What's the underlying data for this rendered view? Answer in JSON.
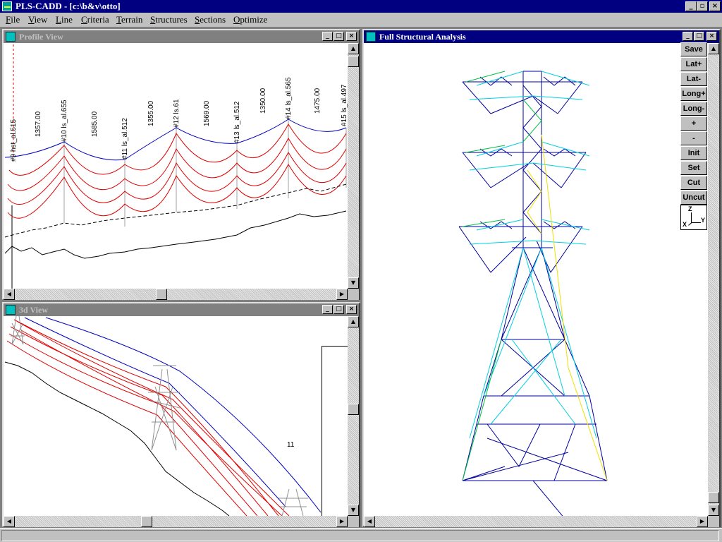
{
  "app": {
    "title": "PLS-CADD - [c:\\b&v\\otto]",
    "window_buttons": {
      "minimize": "_",
      "restore": "▫",
      "close": "×"
    }
  },
  "menu": {
    "items": [
      "File",
      "View",
      "Line",
      "Criteria",
      "Terrain",
      "Structures",
      "Sections",
      "Optimize"
    ]
  },
  "windows": {
    "profile": {
      "title": "Profile View"
    },
    "view3d": {
      "title": "3d View",
      "marker": "11"
    },
    "structural": {
      "title": "Full Structural Analysis"
    }
  },
  "toolbar": {
    "buttons": [
      "Save",
      "Lat+",
      "Lat-",
      "Long+",
      "Long-",
      "+",
      "-",
      "Init",
      "Set",
      "Cut",
      "Uncut"
    ],
    "axis": {
      "z": "Z",
      "x": "X",
      "y": "Y"
    }
  },
  "profile": {
    "structure_labels": [
      {
        "text": "#9 hst_al.515"
      },
      {
        "text": "#10 ls_al.655"
      },
      {
        "text": "#11 ls_al.512"
      },
      {
        "text": "#12 ls.61"
      },
      {
        "text": "#13 ls_al.512"
      },
      {
        "text": "#14 ls_al.565"
      },
      {
        "text": "#15 ls_al.497"
      }
    ],
    "span_labels": [
      "1357.00",
      "1585.00",
      "1355.00",
      "1569.00",
      "1350.00",
      "1475.00"
    ]
  },
  "colors": {
    "titlebar_active": "#000080",
    "titlebar_inactive": "#808080",
    "conductor": "#e00000",
    "shield_wire": "#0000c0",
    "tower_blue": "#0000a0",
    "tower_cyan": "#00d0e0",
    "tower_yellow": "#f0e000",
    "tower_green": "#00c040"
  }
}
